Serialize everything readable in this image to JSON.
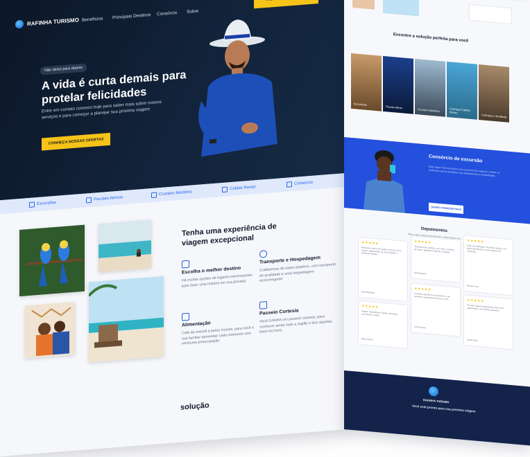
{
  "left": {
    "nav": {
      "brand": "RAFINHA TURISMO",
      "links": [
        "Benefícios",
        "Principais Destinos",
        "Consórcio",
        "Sobre"
      ],
      "cta": "AGENDAR AGORA"
    },
    "hero": {
      "badge": "Não deixe para depois",
      "title": "A vida é curta demais para protelar felicidades",
      "text": "Entre em contato conosco hoje para saber mais sobre nossos serviços e para começar a planejar sua próxima viagem",
      "cta": "CONHEÇA NOSSAS OFERTAS"
    },
    "services": [
      "Excursões",
      "Pacotes Aéreos",
      "Cruzeiro Marítimo",
      "Caldas Novas",
      "Consórcio"
    ],
    "experience": {
      "title": "Tenha uma experiência de viagem excepcional",
      "features": [
        {
          "title": "Escolha o melhor destino",
          "text": "Há muitas opções de lugares interessantes para fazer uma história em sua jornada."
        },
        {
          "title": "Transporte e Hospedagem",
          "text": "Cuidaremos de todos detalhes, com transporte de qualidade e uma hospedagem aconchegante"
        },
        {
          "title": "Alimentação",
          "text": "Café da manhã e jantar incluso, para você e sua familiar aproveitar cada momento sem nenhuma preocupação."
        },
        {
          "title": "Passeio Cortesia",
          "text": "Você GANHA um passeio cortesia, para conhecer ainda mais a região e tirar aquelas fotos incríveis."
        }
      ]
    },
    "bottom_heading": "solução"
  },
  "right": {
    "solution": {
      "title": "Encontre a solução perfeita para você",
      "cards": [
        "Excursões",
        "Pacote Aéreo",
        "Cruzeiro Marítimo",
        "Conheça Caldas Novas",
        "Conheça o Nordeste"
      ]
    },
    "consorcio": {
      "title": "Consórcio de excursão",
      "text": "Quer viajar? Tem um plano com consórcio de viagens e realize os melhores roteiros turísticos com planejamento e tranquilidade.",
      "button": "QUERO CONHECER MAIS"
    },
    "testimonials": {
      "title": "Depoimentos",
      "subtitle": "Veja o que nossos clientes têm a dizer sobre nós",
      "items": [
        {
          "stars": "★★★★★",
          "text": "Nossa tem sido uma viagem incrível com a equipe, organização de cada detalhe e ambiente familiar.",
          "name": "Silvia Barbosa"
        },
        {
          "stars": "★★★★★",
          "text": "Simplesmente perfeito, com todo o conforto do hotel e agradável durante o passeio.",
          "name": "Sandra Alves"
        },
        {
          "stars": "★★★★★",
          "text": "Pode vim indicação. Excelente opção, com ótimo atendimento. Uma empresa de confiança.",
          "name": "Renata Lima"
        },
        {
          "stars": "★★★★★",
          "text": "Viagem maravilhosa, equipe atenciosa, recomendo a todos.",
          "name": "Rosa Nunes"
        },
        {
          "stars": "★★★★★",
          "text": "A minha experiência foi excelente, com conforto e segurança do início ao fim.",
          "name": "Carla Souza"
        },
        {
          "stars": "★★★★★",
          "text": "Foi uma viagem espetacular, muito bem organizada e com ótimos passeios.",
          "name": "Joana Silva"
        }
      ]
    },
    "footer": {
      "brand": "RAFINHA TURISMO",
      "text": "Você está pronto para sua próxima viagem"
    }
  }
}
